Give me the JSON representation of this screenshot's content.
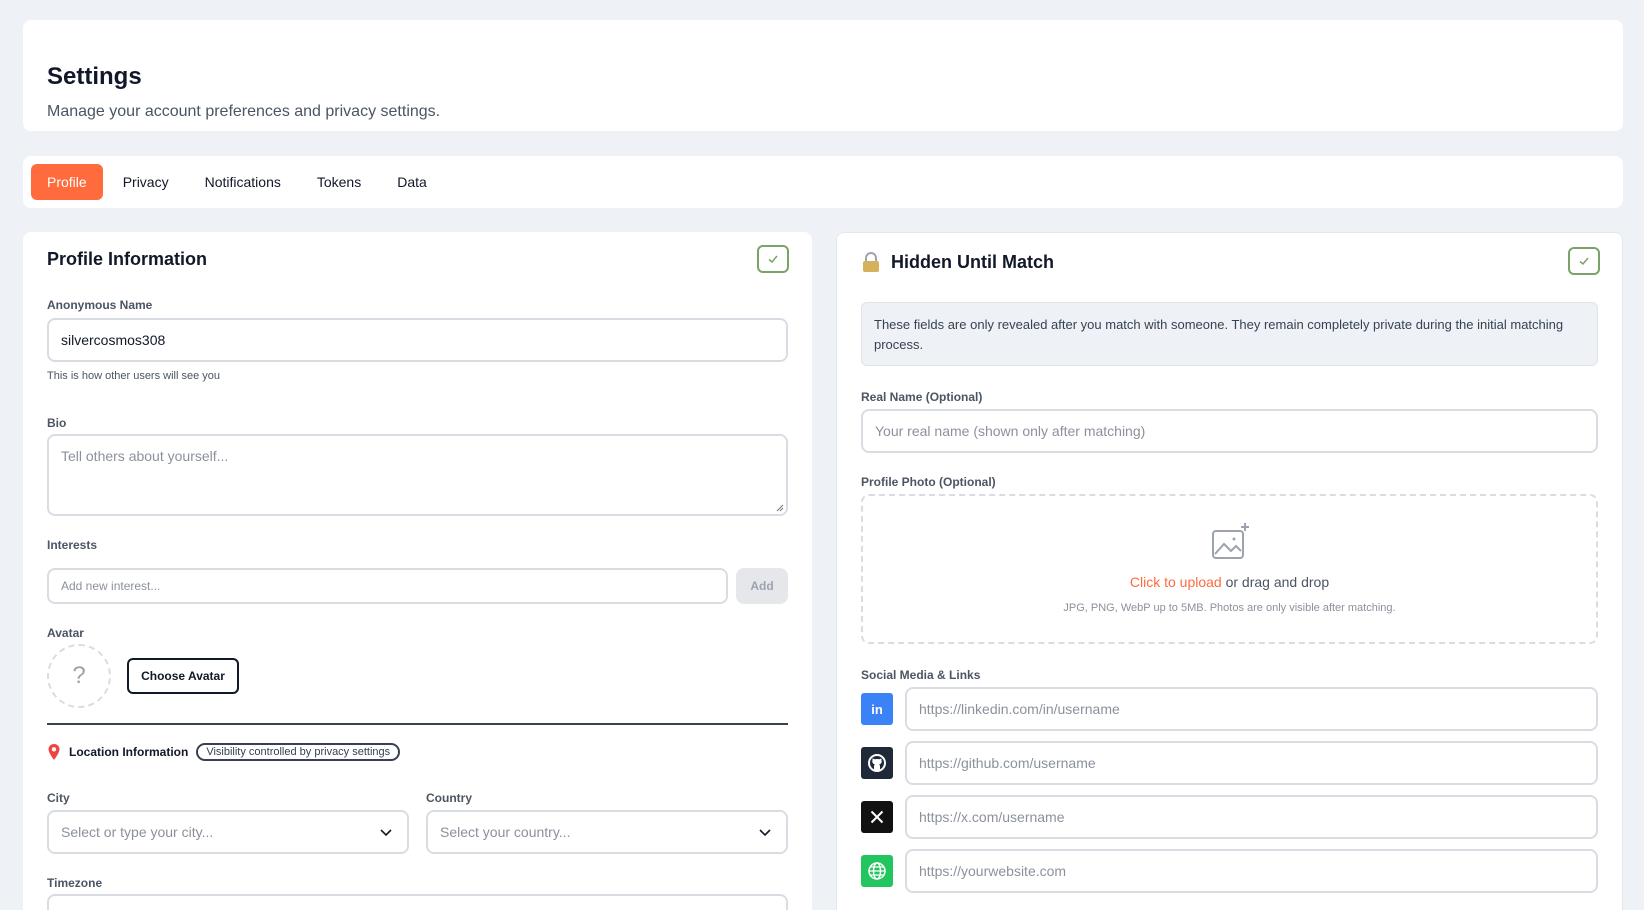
{
  "header": {
    "title": "Settings",
    "subtitle": "Manage your account preferences and privacy settings."
  },
  "tabs": [
    {
      "label": "Profile",
      "active": true
    },
    {
      "label": "Privacy",
      "active": false
    },
    {
      "label": "Notifications",
      "active": false
    },
    {
      "label": "Tokens",
      "active": false
    },
    {
      "label": "Data",
      "active": false
    }
  ],
  "profile": {
    "title": "Profile Information",
    "anon_name_label": "Anonymous Name",
    "anon_name_value": "silvercosmos308",
    "anon_name_hint": "This is how other users will see you",
    "bio_label": "Bio",
    "bio_placeholder": "Tell others about yourself...",
    "interests_label": "Interests",
    "interests_placeholder": "Add new interest...",
    "add_label": "Add",
    "avatar_label": "Avatar",
    "avatar_placeholder": "?",
    "choose_avatar_label": "Choose Avatar",
    "location_title": "Location Information",
    "visibility_badge": "Visibility controlled by privacy settings",
    "city_label": "City",
    "city_placeholder": "Select or type your city...",
    "country_label": "Country",
    "country_placeholder": "Select your country...",
    "timezone_label": "Timezone"
  },
  "hidden": {
    "title": "Hidden Until Match",
    "notice": "These fields are only revealed after you match with someone. They remain completely private during the initial matching process.",
    "real_name_label": "Real Name (Optional)",
    "real_name_placeholder": "Your real name (shown only after matching)",
    "photo_label": "Profile Photo (Optional)",
    "upload_link": "Click to upload",
    "upload_rest": " or drag and drop",
    "upload_hint": "JPG, PNG, WebP up to 5MB. Photos are only visible after matching.",
    "social_label": "Social Media & Links",
    "socials": [
      {
        "icon": "linkedin-icon",
        "glyph": "in",
        "color": "#3b82f6",
        "placeholder": "https://linkedin.com/in/username"
      },
      {
        "icon": "github-icon",
        "glyph": "",
        "color": "#1f2937",
        "placeholder": "https://github.com/username"
      },
      {
        "icon": "x-icon",
        "glyph": "𝕏",
        "color": "#111111",
        "placeholder": "https://x.com/username"
      },
      {
        "icon": "globe-icon",
        "glyph": "",
        "color": "#22c55e",
        "placeholder": "https://yourwebsite.com"
      }
    ]
  },
  "colors": {
    "accent": "#ff6b3d",
    "check_border": "#7aa36a",
    "page_bg": "#eef2f7"
  }
}
